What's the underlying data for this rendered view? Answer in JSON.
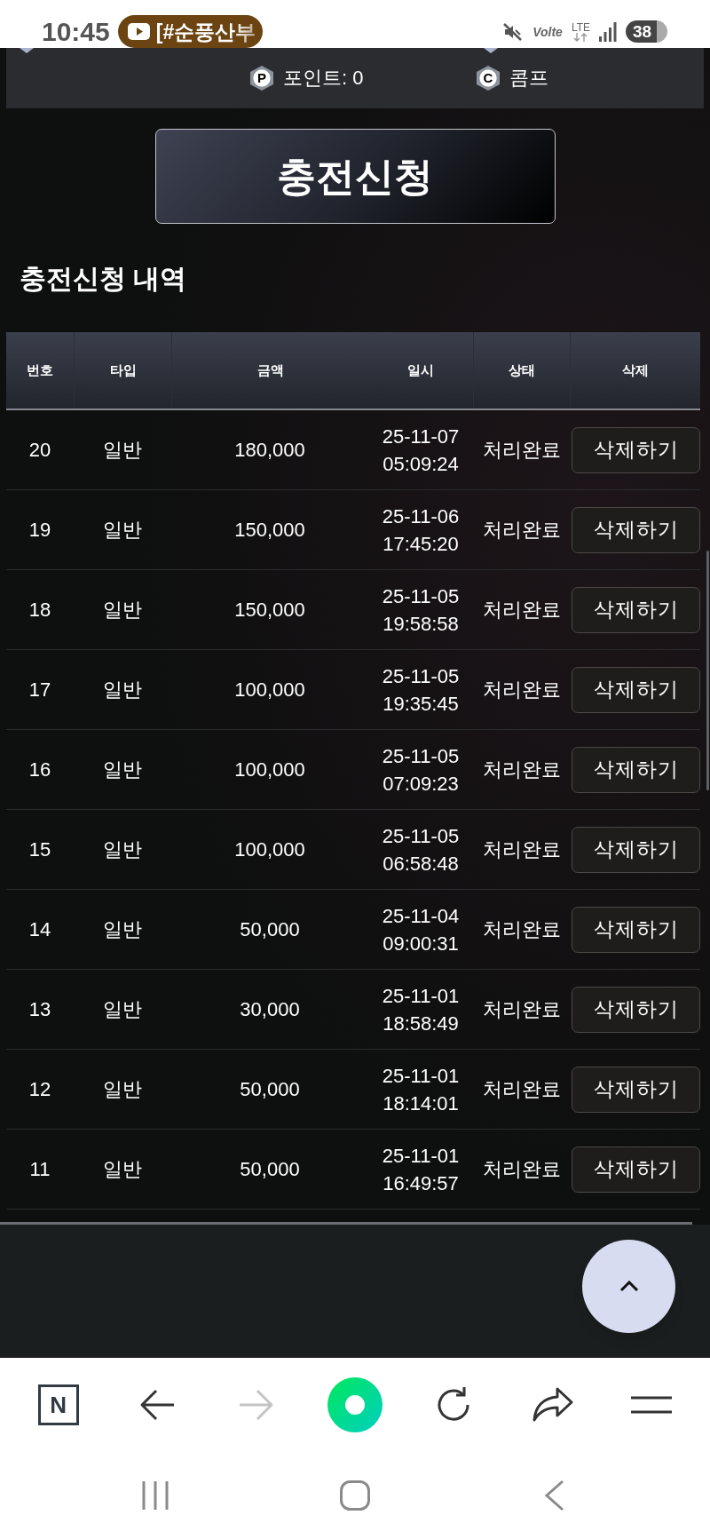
{
  "status_bar": {
    "time": "10:45",
    "notification": "[#순풍산부",
    "volte": "Volte",
    "network": "LTE",
    "battery": "38"
  },
  "account_bar": {
    "points_badge": "P",
    "points": "포인트: 0",
    "comp_badge": "C",
    "comp": "콤프"
  },
  "charge_button": "충전신청",
  "history": {
    "title": "충전신청 내역",
    "columns": [
      "번호",
      "타입",
      "금액",
      "일시",
      "상태",
      "삭제"
    ],
    "rows": [
      {
        "no": "20",
        "type": "일반",
        "amount": "180,000",
        "datetime": "25-11-07 05:09:24",
        "status": "처리완료",
        "action": "삭제하기"
      },
      {
        "no": "19",
        "type": "일반",
        "amount": "150,000",
        "datetime": "25-11-06 17:45:20",
        "status": "처리완료",
        "action": "삭제하기"
      },
      {
        "no": "18",
        "type": "일반",
        "amount": "150,000",
        "datetime": "25-11-05 19:58:58",
        "status": "처리완료",
        "action": "삭제하기"
      },
      {
        "no": "17",
        "type": "일반",
        "amount": "100,000",
        "datetime": "25-11-05 19:35:45",
        "status": "처리완료",
        "action": "삭제하기"
      },
      {
        "no": "16",
        "type": "일반",
        "amount": "100,000",
        "datetime": "25-11-05 07:09:23",
        "status": "처리완료",
        "action": "삭제하기"
      },
      {
        "no": "15",
        "type": "일반",
        "amount": "100,000",
        "datetime": "25-11-05 06:58:48",
        "status": "처리완료",
        "action": "삭제하기"
      },
      {
        "no": "14",
        "type": "일반",
        "amount": "50,000",
        "datetime": "25-11-04 09:00:31",
        "status": "처리완료",
        "action": "삭제하기"
      },
      {
        "no": "13",
        "type": "일반",
        "amount": "30,000",
        "datetime": "25-11-01 18:58:49",
        "status": "처리완료",
        "action": "삭제하기"
      },
      {
        "no": "12",
        "type": "일반",
        "amount": "50,000",
        "datetime": "25-11-01 18:14:01",
        "status": "처리완료",
        "action": "삭제하기"
      },
      {
        "no": "11",
        "type": "일반",
        "amount": "50,000",
        "datetime": "25-11-01 16:49:57",
        "status": "처리완료",
        "action": "삭제하기"
      }
    ]
  },
  "browser_toolbar": {
    "logo": "N"
  }
}
